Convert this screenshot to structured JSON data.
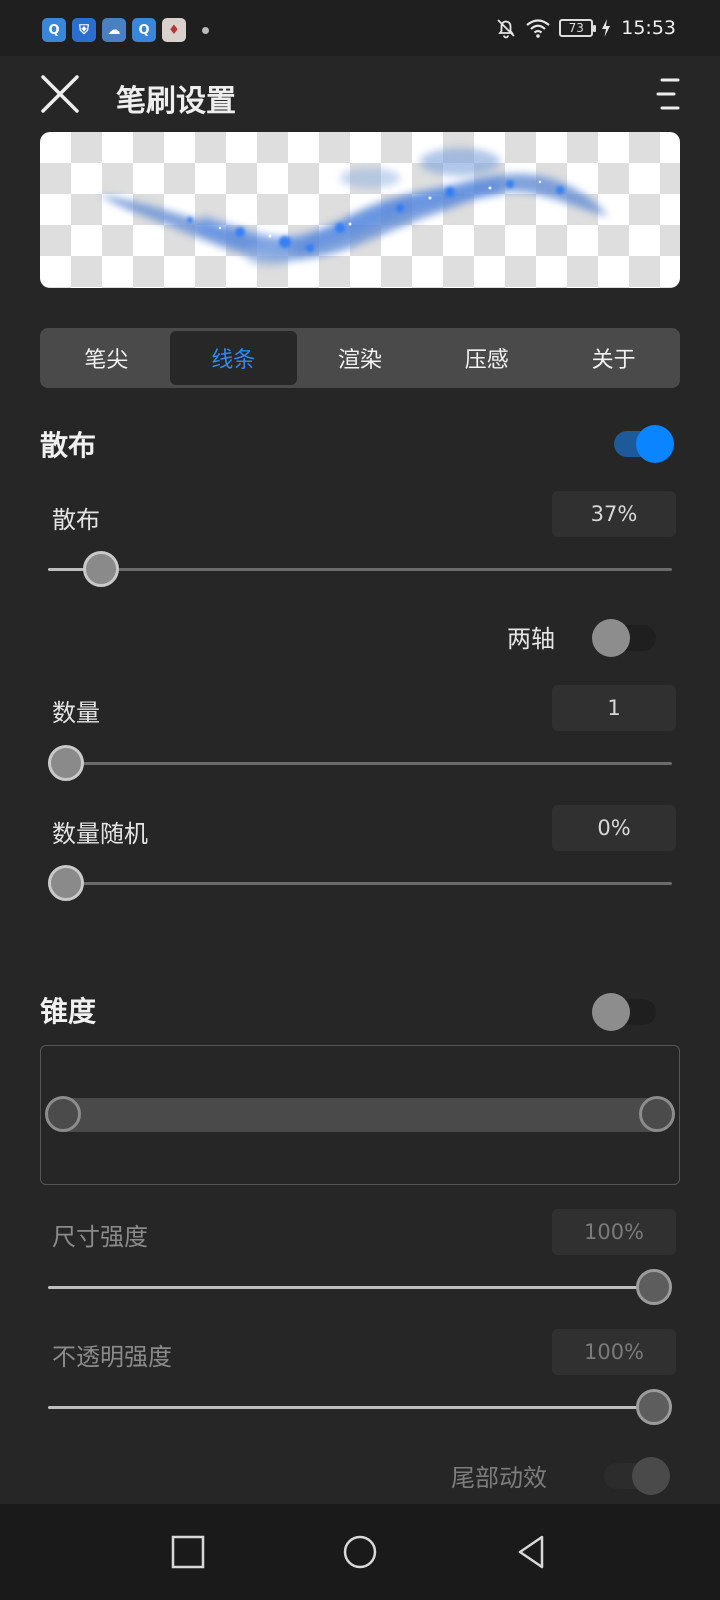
{
  "status_bar": {
    "app_icons": [
      "q-app-icon",
      "shield-app-icon",
      "weather-app-icon",
      "q-app-icon",
      "card-app-icon"
    ],
    "battery": "73",
    "time": "15:53"
  },
  "header": {
    "title": "笔刷设置"
  },
  "tabs": [
    {
      "label": "笔尖",
      "active": false
    },
    {
      "label": "线条",
      "active": true
    },
    {
      "label": "渲染",
      "active": false
    },
    {
      "label": "压感",
      "active": false
    },
    {
      "label": "关于",
      "active": false
    }
  ],
  "scatter": {
    "title": "散布",
    "enabled": true,
    "scatter_label": "散布",
    "scatter_value": "37%",
    "scatter_level": 0.06,
    "two_axis_label": "两轴",
    "two_axis_enabled": false,
    "count_label": "数量",
    "count_value": "1",
    "count_level": 0.0,
    "count_random_label": "数量随机",
    "count_random_value": "0%",
    "count_random_level": 0.0
  },
  "taper": {
    "title": "锥度",
    "enabled": false,
    "size_strength_label": "尺寸强度",
    "size_strength_value": "100%",
    "size_strength_level": 1.0,
    "opacity_strength_label": "不透明强度",
    "opacity_strength_value": "100%",
    "opacity_strength_level": 1.0,
    "tail_effect_label": "尾部动效",
    "tail_effect_enabled": false
  },
  "colors": {
    "accent": "#0a84ff",
    "tab_active_text": "#2b8bf2",
    "background": "#262626"
  }
}
